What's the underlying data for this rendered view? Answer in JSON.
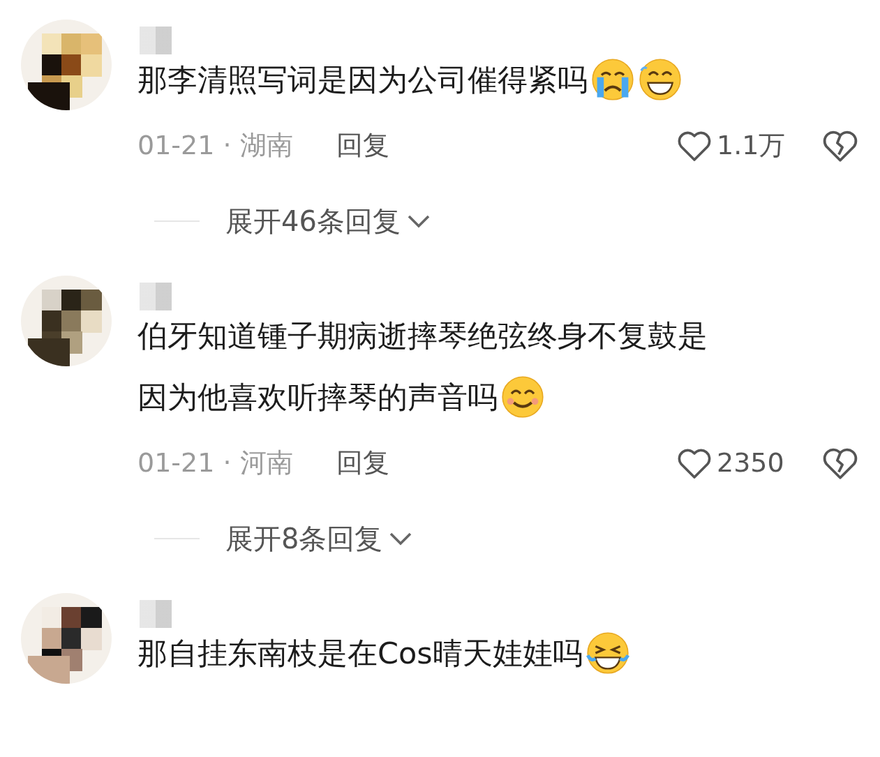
{
  "comments": [
    {
      "lines": [
        "那李清照写词是因为公司催得紧吗"
      ],
      "emojis": [
        {
          "kind": "crying"
        },
        {
          "kind": "grin"
        }
      ],
      "date": "01-21 · 湖南",
      "reply": "回复",
      "likes": "1.1万",
      "expand": "展开46条回复"
    },
    {
      "lines": [
        "伯牙知道锺子期病逝摔琴绝弦终身不复鼓是",
        "因为他喜欢听摔琴的声音吗"
      ],
      "emojis": [
        {
          "kind": "smile"
        }
      ],
      "date": "01-21 · 河南",
      "reply": "回复",
      "likes": "2350",
      "expand": "展开8条回复"
    },
    {
      "lines": [
        "那自挂东南枝是在Cos晴天娃娃吗"
      ],
      "emojis": [
        {
          "kind": "laugh"
        }
      ]
    }
  ]
}
